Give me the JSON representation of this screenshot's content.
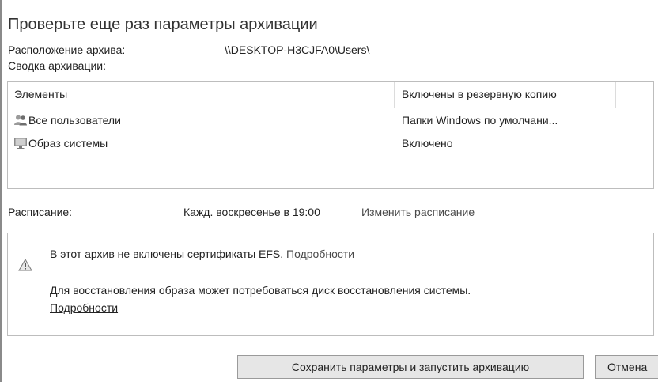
{
  "title": "Проверьте еще раз параметры архивации",
  "location": {
    "label": "Расположение архива:",
    "value": "\\\\DESKTOP-H3CJFA0\\Users\\"
  },
  "summary_label": "Сводка архивации:",
  "table": {
    "columns": [
      "Элементы",
      "Включены в резервную копию"
    ],
    "rows": [
      {
        "icon": "users-icon",
        "item": "Все пользователи",
        "included": "Папки Windows по умолчани..."
      },
      {
        "icon": "monitor-icon",
        "item": "Образ системы",
        "included": "Включено"
      }
    ]
  },
  "schedule": {
    "label": "Расписание:",
    "value": "Кажд. воскресенье в 19:00",
    "change_link": "Изменить расписание"
  },
  "warnings": {
    "icon": "warning-icon",
    "efs_text": "В этот архив не включены сертификаты EFS.",
    "efs_link": "Подробности",
    "recovery_text": "Для восстановления образа может потребоваться диск восстановления системы.",
    "recovery_link": "Подробности"
  },
  "buttons": {
    "save_label": "Сохранить параметры и запустить архивацию",
    "cancel_label": "Отмена"
  }
}
